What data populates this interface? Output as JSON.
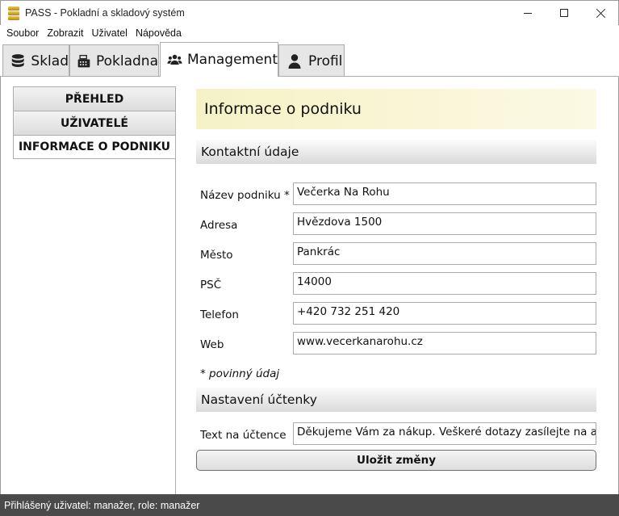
{
  "window": {
    "title": "PASS - Pokladní a skladový systém"
  },
  "menu": [
    "Soubor",
    "Zobrazit",
    "Uživatel",
    "Nápověda"
  ],
  "tabs": [
    {
      "label": "Sklad",
      "icon": "database-icon"
    },
    {
      "label": "Pokladna",
      "icon": "cash-register-icon"
    },
    {
      "label": "Management",
      "icon": "users-icon",
      "active": true
    },
    {
      "label": "Profil",
      "icon": "user-icon"
    }
  ],
  "nav": [
    {
      "label": "PŘEHLED"
    },
    {
      "label": "UŽIVATELÉ"
    },
    {
      "label": "INFORMACE O PODNIKU",
      "selected": true
    }
  ],
  "page": {
    "title": "Informace o podniku",
    "contact_section": "Kontaktní údaje",
    "fields": [
      {
        "label": "Název podniku *",
        "value": "Večerka Na Rohu"
      },
      {
        "label": "Adresa",
        "value": "Hvězdova 1500"
      },
      {
        "label": "Město",
        "value": "Pankrác"
      },
      {
        "label": "PSČ",
        "value": "14000"
      },
      {
        "label": "Telefon",
        "value": "+420 732 251 420"
      },
      {
        "label": "Web",
        "value": "www.vecerkanarohu.cz"
      }
    ],
    "required_note": "* povinný údaj",
    "receipt_section": "Nastavení účtenky",
    "receipt_field": {
      "label": "Text na účtence",
      "value": "Děkujeme Vám za nákup. Veškeré dotazy zasílejte na adresu"
    },
    "save_label": "Uložit změny"
  },
  "status": "Přihlášený uživatel: manažer, role: manažer",
  "colors": {
    "header_bg": "#f6f2c6",
    "status_bg": "#4a4a4a",
    "tab_border": "#acacac"
  }
}
